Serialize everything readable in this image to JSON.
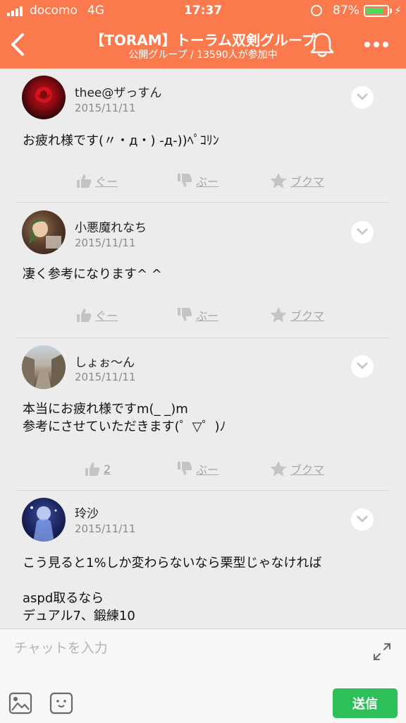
{
  "status_bar": {
    "carrier": "docomo",
    "network": "4G",
    "time": "17:37",
    "battery_percent": "87%",
    "battery_level": 0.87
  },
  "header": {
    "title": "【TORAM】トーラム双剣グループ",
    "subtitle": "公開グループ / 13590人が参加中",
    "accent_color": "#fa7a4d"
  },
  "posts": [
    {
      "username": "thee@ザっすん",
      "date": "2015/11/11",
      "body": [
        "お疲れ様です(〃・д・) -д-))ﾍﾟｺﾘﾝ"
      ],
      "like_label": "ぐー",
      "dislike_label": "ぶー",
      "bookmark_label": "ブクマ"
    },
    {
      "username": "小悪魔れなち",
      "date": "2015/11/11",
      "body": [
        "凄く参考になります^ ^"
      ],
      "like_label": "ぐー",
      "dislike_label": "ぶー",
      "bookmark_label": "ブクマ"
    },
    {
      "username": "しょぉ〜ん",
      "date": "2015/11/11",
      "body": [
        "本当にお疲れ様ですm(_ _)m",
        "参考にさせていただきます(゜▽゜)ﾉ"
      ],
      "like_label": "2",
      "dislike_label": "ぶー",
      "bookmark_label": "ブクマ"
    },
    {
      "username": "玲沙",
      "date": "2015/11/11",
      "body": [
        "こう見ると1%しか変わらないなら栗型じゃなければ",
        "",
        "aspd取るなら",
        "デュアル7、鍛練10"
      ]
    }
  ],
  "input_bar": {
    "placeholder": "チャットを入力",
    "send_label": "送信",
    "send_color": "#2fbf5a"
  }
}
